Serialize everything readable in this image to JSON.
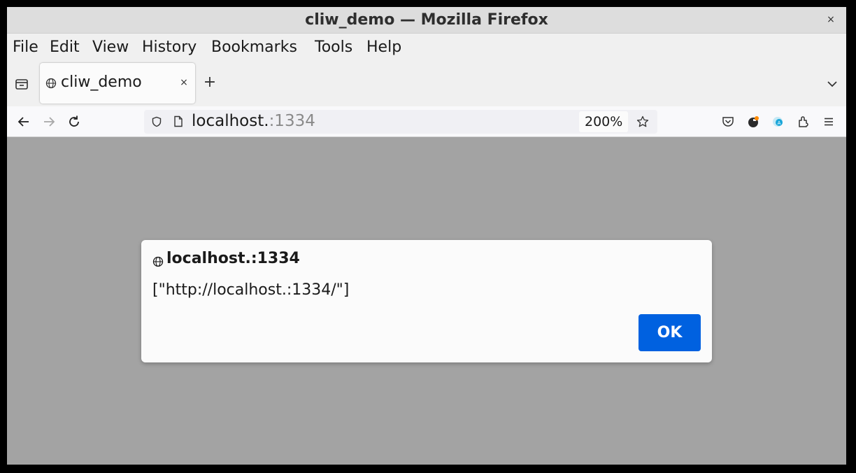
{
  "window": {
    "title": "cliw_demo — Mozilla Firefox",
    "close_label": "×"
  },
  "menubar": {
    "items": [
      {
        "label": "File"
      },
      {
        "label": "Edit"
      },
      {
        "label": "View"
      },
      {
        "label": "History"
      },
      {
        "label": "Bookmarks"
      },
      {
        "label": "Tools"
      },
      {
        "label": "Help"
      }
    ]
  },
  "tabs": [
    {
      "label": "cliw_demo",
      "active": true,
      "close_label": "×"
    }
  ],
  "newtab_label": "+",
  "navbar": {
    "url_host": "localhost.",
    "url_port": ":1334",
    "zoom": "200%"
  },
  "toolbar_icons": [
    "pocket-icon",
    "firefox-account-icon",
    "extension-icon",
    "puzzle-icon",
    "hamburger-menu-icon"
  ],
  "dialog": {
    "title": "localhost.:1334",
    "message": "[\"http://localhost.:1334/\"]",
    "ok_label": "OK"
  },
  "colors": {
    "accent": "#0061e0",
    "content_background": "#a3a3a3"
  }
}
